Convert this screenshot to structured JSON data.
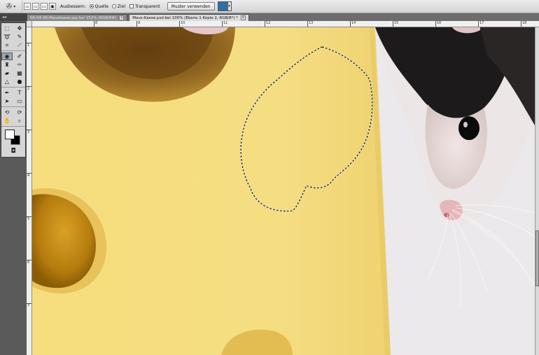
{
  "options_bar": {
    "tool_preset_icon": "patch-tool-icon",
    "mode_label": "Ausbessern:",
    "source_label": "Quelle",
    "destination_label": "Ziel",
    "transparent_label": "Transparent",
    "use_pattern_label": "Muster verwenden",
    "patch_mode": "Quelle"
  },
  "tabs": [
    {
      "label": "06-04-06-Mauskaese.jpg bei 152% (RGB/8#)",
      "active": false
    },
    {
      "label": "Maus-Kaese.psd bei 100% (Ebene 1 Kopie 2, RGB/8*) *",
      "active": true
    }
  ],
  "toolbox": {
    "header": "◂◂",
    "tools": [
      "marquee-icon",
      "move-icon",
      "lasso-icon",
      "quick-select-icon",
      "crop-icon",
      "eyedropper-icon",
      "patch-icon",
      "brush-icon",
      "stamp-icon",
      "history-brush-icon",
      "eraser-icon",
      "gradient-icon",
      "blur-icon",
      "dodge-icon",
      "pen-icon",
      "type-icon",
      "path-select-icon",
      "shape-icon",
      "3d-rotate-icon",
      "3d-orbit-icon",
      "hand-icon",
      "zoom-icon"
    ],
    "foreground_color": "#ffffff",
    "background_color": "#000000"
  },
  "ruler": {
    "top_numbers": [
      "8",
      "9",
      "10",
      "11",
      "12",
      "13",
      "14",
      "15",
      "16",
      "17",
      "18",
      "19"
    ],
    "left_numbers": [
      "1",
      "2",
      "3",
      "4",
      "5",
      "6",
      "7"
    ]
  },
  "colors": {
    "cheese": "#f4dc7c",
    "hole": "#c08a12",
    "background": "#ebe9ec",
    "accent": "#2f6ea8"
  }
}
